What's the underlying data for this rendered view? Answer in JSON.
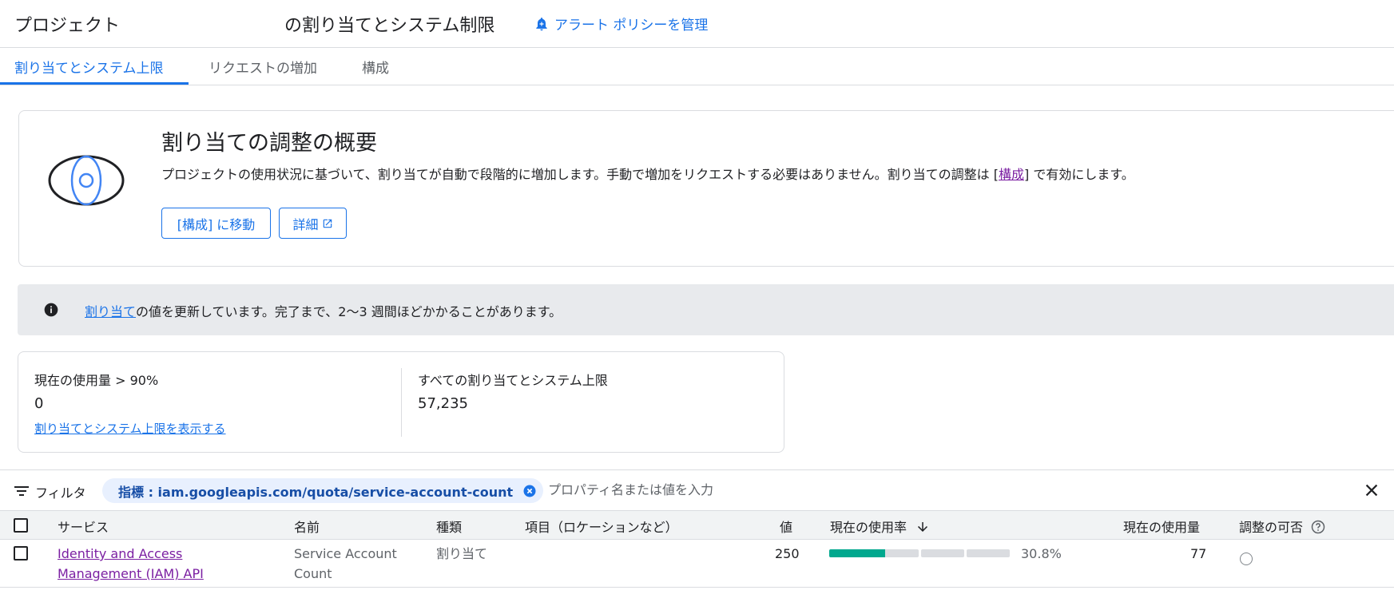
{
  "header": {
    "project": "プロジェクト",
    "title": "の割り当てとシステム制限",
    "alert_link": "アラート ポリシーを管理"
  },
  "tabs": [
    {
      "label": "割り当てとシステム上限"
    },
    {
      "label": "リクエストの増加"
    },
    {
      "label": "構成"
    }
  ],
  "overview": {
    "title": "割り当ての調整の概要",
    "desc_before": "プロジェクトの使用状況に基づいて、割り当てが自動で段階的に増加します。手動で増加をリクエストする必要はありません。割り当ての調整は [",
    "desc_link": "構成",
    "desc_after": "] で有効にします。",
    "button_configure": "[構成] に移動",
    "button_details": "詳細"
  },
  "banner": {
    "link": "割り当て",
    "text": "の値を更新しています。完了まで、2〜3 週間ほどかかることがあります。"
  },
  "stats": {
    "usage_label": "現在の使用量 > 90%",
    "usage_value": "0",
    "usage_link": "割り当てとシステム上限を表示する",
    "total_label": "すべての割り当てとシステム上限",
    "total_value": "57,235"
  },
  "filter": {
    "label": "フィルタ",
    "chip": "指標 : iam.googleapis.com/quota/service-account-count",
    "placeholder": "プロパティ名または値を入力"
  },
  "table": {
    "columns": [
      "サービス",
      "名前",
      "種類",
      "項目（ロケーションなど）",
      "値",
      "現在の使用率",
      "現在の使用量",
      "調整の可否"
    ],
    "rows": [
      {
        "service_line1": "Identity and Access",
        "service_line2": "Management (IAM) API",
        "name_line1": "Service Account",
        "name_line2": "Count",
        "type": "割り当て",
        "dimension": "",
        "value": "250",
        "usage_percent": "30.8%",
        "usage_fraction": 0.308,
        "usage": "77"
      }
    ]
  },
  "colors": {
    "accent": "#1a73e8",
    "link_visited": "#7b1fa2",
    "usage_bar": "#00a88e"
  }
}
